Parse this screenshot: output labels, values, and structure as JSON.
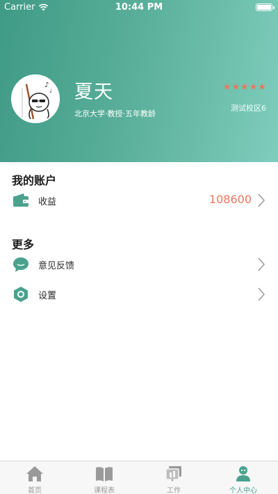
{
  "status_bar": {
    "carrier": "Carrier",
    "time": "10:44 PM"
  },
  "profile": {
    "name": "夏天",
    "subtitle": "北京大学·教授·五年教龄",
    "rating": 5,
    "campus": "测试校区6",
    "star_color": "#e9785c"
  },
  "account": {
    "title": "我的账户",
    "items": [
      {
        "label": "收益",
        "value": "108600",
        "icon": "wallet-icon"
      }
    ]
  },
  "more": {
    "title": "更多",
    "items": [
      {
        "label": "意见反馈",
        "icon": "chat-bubble-icon"
      },
      {
        "label": "设置",
        "icon": "settings-hexagon-icon"
      }
    ]
  },
  "tabbar": {
    "tabs": [
      {
        "label": "首页",
        "icon": "home-icon",
        "active": false
      },
      {
        "label": "课程表",
        "icon": "book-icon",
        "active": false
      },
      {
        "label": "工作",
        "icon": "work-icon",
        "active": false
      },
      {
        "label": "个人中心",
        "icon": "person-icon",
        "active": true
      }
    ]
  },
  "colors": {
    "accent": "#4aa28d",
    "value": "#e9785c",
    "inactive": "#9a9a9a"
  }
}
